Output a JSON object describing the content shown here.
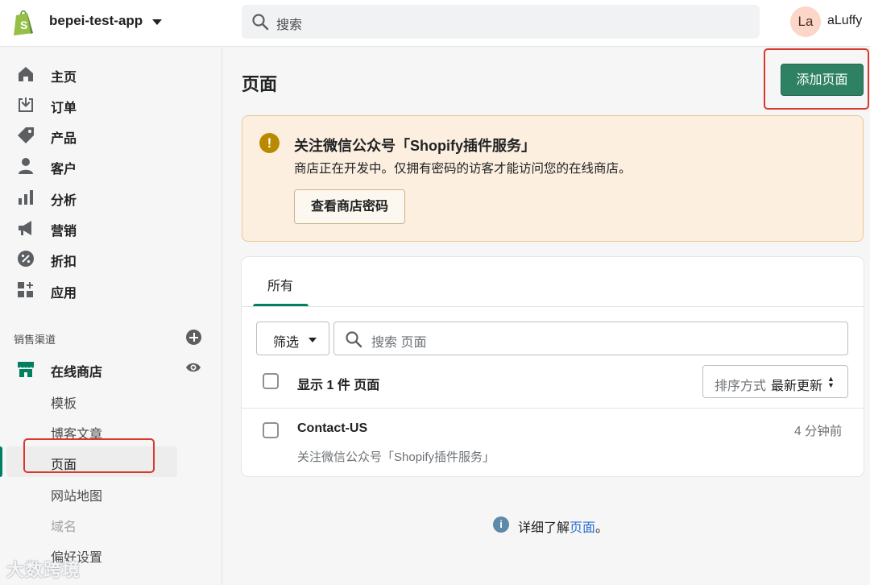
{
  "topbar": {
    "store_name": "bepei-test-app",
    "search_placeholder": "搜索",
    "avatar_initials": "La",
    "user_name": "aLuffy"
  },
  "sidebar": {
    "items": [
      {
        "label": "主页",
        "icon": "home-icon"
      },
      {
        "label": "订单",
        "icon": "orders-icon"
      },
      {
        "label": "产品",
        "icon": "tag-icon"
      },
      {
        "label": "客户",
        "icon": "person-icon"
      },
      {
        "label": "分析",
        "icon": "bar-chart-icon"
      },
      {
        "label": "营销",
        "icon": "megaphone-icon"
      },
      {
        "label": "折扣",
        "icon": "discount-icon"
      },
      {
        "label": "应用",
        "icon": "apps-icon"
      }
    ],
    "section_label": "销售渠道",
    "channel": {
      "label": "在线商店",
      "icon": "storefront-icon"
    },
    "sub_items": [
      {
        "label": "模板"
      },
      {
        "label": "博客文章"
      },
      {
        "label": "页面"
      },
      {
        "label": "网站地图"
      },
      {
        "label": "域名"
      },
      {
        "label": "偏好设置"
      }
    ]
  },
  "main": {
    "title": "页面",
    "add_button": "添加页面",
    "banner": {
      "title": "关注微信公众号「Shopify插件服务」",
      "description": "商店正在开发中。仅拥有密码的访客才能访问您的在线商店。",
      "button": "查看商店密码",
      "icon_glyph": "!"
    },
    "tabs": [
      {
        "label": "所有"
      }
    ],
    "filter_label": "筛选",
    "search_placeholder": "搜索 页面",
    "count_label": "显示 1 件 页面",
    "sort_label": "排序方式",
    "sort_value": "最新更新",
    "rows": [
      {
        "title": "Contact-US",
        "subtitle": "关注微信公众号「Shopify插件服务」",
        "time": "4 分钟前"
      }
    ],
    "learn_more_prefix": "详细了解",
    "learn_more_link": "页面",
    "learn_more_suffix": "。"
  },
  "watermark": "大数跨境",
  "colors": {
    "primary": "#2e8263",
    "highlight_box": "#d9382a",
    "banner_bg": "#fdefe0",
    "link": "#2c6ecb"
  }
}
